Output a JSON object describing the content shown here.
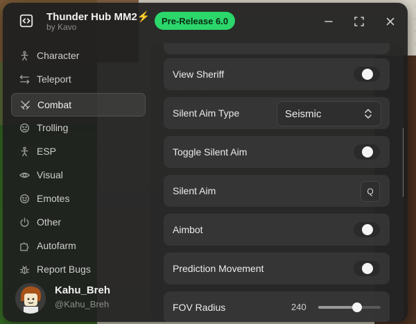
{
  "header": {
    "title": "Thunder Hub MM2⚡",
    "subtitle": "by Kavo",
    "badge": "Pre-Release 6.0"
  },
  "sidebar": {
    "items": [
      {
        "label": "Character",
        "icon": "person-icon"
      },
      {
        "label": "Teleport",
        "icon": "arrows-swap-icon"
      },
      {
        "label": "Combat",
        "icon": "crossed-swords-icon",
        "active": true
      },
      {
        "label": "Trolling",
        "icon": "face-icon"
      },
      {
        "label": "ESP",
        "icon": "person-icon"
      },
      {
        "label": "Visual",
        "icon": "eye-icon"
      },
      {
        "label": "Emotes",
        "icon": "emoji-icon"
      },
      {
        "label": "Other",
        "icon": "power-icon"
      },
      {
        "label": "Autofarm",
        "icon": "puzzle-icon"
      },
      {
        "label": "Report Bugs",
        "icon": "bug-icon"
      }
    ]
  },
  "user": {
    "name": "Kahu_Breh",
    "handle": "@Kahu_Breh"
  },
  "content": {
    "view_sheriff": {
      "label": "View Sheriff",
      "on": false
    },
    "silent_aim_type": {
      "label": "Silent Aim Type",
      "value": "Seismic"
    },
    "toggle_silent_aim": {
      "label": "Toggle Silent Aim",
      "on": false
    },
    "silent_aim": {
      "label": "Silent Aim",
      "key": "Q"
    },
    "aimbot": {
      "label": "Aimbot",
      "on": false
    },
    "prediction_movement": {
      "label": "Prediction Movement",
      "on": false
    },
    "fov_radius": {
      "label": "FOV Radius",
      "value": "240",
      "fraction": 0.62
    }
  },
  "colors": {
    "badge": "#2bd66b",
    "window": "#1e1e1e",
    "row": "#373737"
  }
}
